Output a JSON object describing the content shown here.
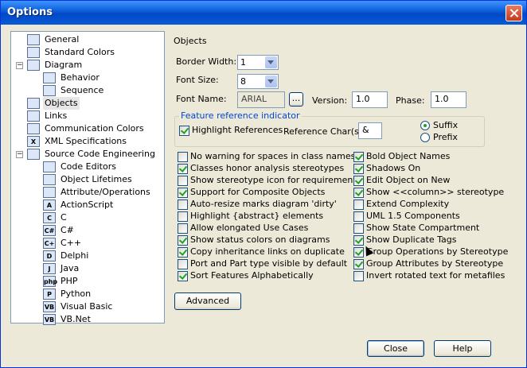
{
  "window": {
    "title": "Options"
  },
  "tree": [
    {
      "label": "General",
      "icon": "general-icon",
      "level": 1
    },
    {
      "label": "Standard Colors",
      "icon": "colors-icon",
      "level": 1
    },
    {
      "label": "Diagram",
      "icon": "diagram-icon",
      "level": 0
    },
    {
      "label": "Behavior",
      "icon": "behavior-icon",
      "level": 2
    },
    {
      "label": "Sequence",
      "icon": "sequence-icon",
      "level": 2
    },
    {
      "label": "Objects",
      "icon": "objects-icon",
      "level": 1,
      "selected": true
    },
    {
      "label": "Links",
      "icon": "links-icon",
      "level": 1
    },
    {
      "label": "Communication Colors",
      "icon": "communication-colors-icon",
      "level": 1
    },
    {
      "label": "XML Specifications",
      "icon": "xml-icon",
      "level": 1
    },
    {
      "label": "Source Code Engineering",
      "icon": "source-code-icon",
      "level": 0
    },
    {
      "label": "Code Editors",
      "icon": "code-editors-icon",
      "level": 2
    },
    {
      "label": "Object Lifetimes",
      "icon": "object-lifetimes-icon",
      "level": 2
    },
    {
      "label": "Attribute/Operations",
      "icon": "attribute-operations-icon",
      "level": 2
    },
    {
      "label": "ActionScript",
      "icon": "actionscript-icon",
      "level": 2
    },
    {
      "label": "C",
      "icon": "c-icon",
      "level": 2
    },
    {
      "label": "C#",
      "icon": "csharp-icon",
      "level": 2
    },
    {
      "label": "C++",
      "icon": "cpp-icon",
      "level": 2
    },
    {
      "label": "Delphi",
      "icon": "delphi-icon",
      "level": 2
    },
    {
      "label": "Java",
      "icon": "java-icon",
      "level": 2
    },
    {
      "label": "PHP",
      "icon": "php-icon",
      "level": 2
    },
    {
      "label": "Python",
      "icon": "python-icon",
      "level": 2
    },
    {
      "label": "Visual Basic",
      "icon": "visual-basic-icon",
      "level": 2
    },
    {
      "label": "VB.Net",
      "icon": "vbnet-icon",
      "level": 2
    }
  ],
  "objects": {
    "section_title": "Objects",
    "border_width_label": "Border Width:",
    "border_width_value": "1",
    "font_size_label": "Font Size:",
    "font_size_value": "8",
    "font_name_label": "Font Name:",
    "font_name_value": "ARIAL",
    "font_browse": "...",
    "version_label": "Version:",
    "version_value": "1.0",
    "phase_label": "Phase:",
    "phase_value": "1.0",
    "feature_ref_title": "Feature reference indicator",
    "highlight_refs_label": "Highlight References",
    "ref_chars_label": "Reference Char(s)",
    "ref_chars_value": "&",
    "suffix_label": "Suffix",
    "prefix_label": "Prefix",
    "left_options": [
      {
        "label": "No warning for spaces in class names",
        "checked": false
      },
      {
        "label": "Classes honor analysis stereotypes",
        "checked": true
      },
      {
        "label": "Show stereotype icon for requirements",
        "checked": false
      },
      {
        "label": "Support for Composite Objects",
        "checked": true
      },
      {
        "label": "Auto-resize marks diagram 'dirty'",
        "checked": false
      },
      {
        "label": "Highlight {abstract} elements",
        "checked": false
      },
      {
        "label": "Allow elongated Use Cases",
        "checked": false
      },
      {
        "label": "Show status colors on diagrams",
        "checked": true
      },
      {
        "label": "Copy inheritance links on duplicate",
        "checked": true
      },
      {
        "label": "Port and Part type visible by default",
        "checked": false
      },
      {
        "label": "Sort Features Alphabetically",
        "checked": true
      }
    ],
    "right_options": [
      {
        "label": "Bold Object Names",
        "checked": true
      },
      {
        "label": "Shadows On",
        "checked": true
      },
      {
        "label": "Edit Object on New",
        "checked": true
      },
      {
        "label": "Show <<column>> stereotype",
        "checked": true
      },
      {
        "label": "Extend Complexity",
        "checked": false
      },
      {
        "label": "UML 1.5 Components",
        "checked": false
      },
      {
        "label": "Show State Compartment",
        "checked": false
      },
      {
        "label": "Show Duplicate Tags",
        "checked": true
      },
      {
        "label": "Group Operations by Stereotype",
        "checked": true
      },
      {
        "label": "Group Attributes by Stereotype",
        "checked": true
      },
      {
        "label": "Invert rotated text for metafiles",
        "checked": false
      }
    ],
    "advanced_label": "Advanced"
  },
  "footer": {
    "close_label": "Close",
    "help_label": "Help"
  }
}
